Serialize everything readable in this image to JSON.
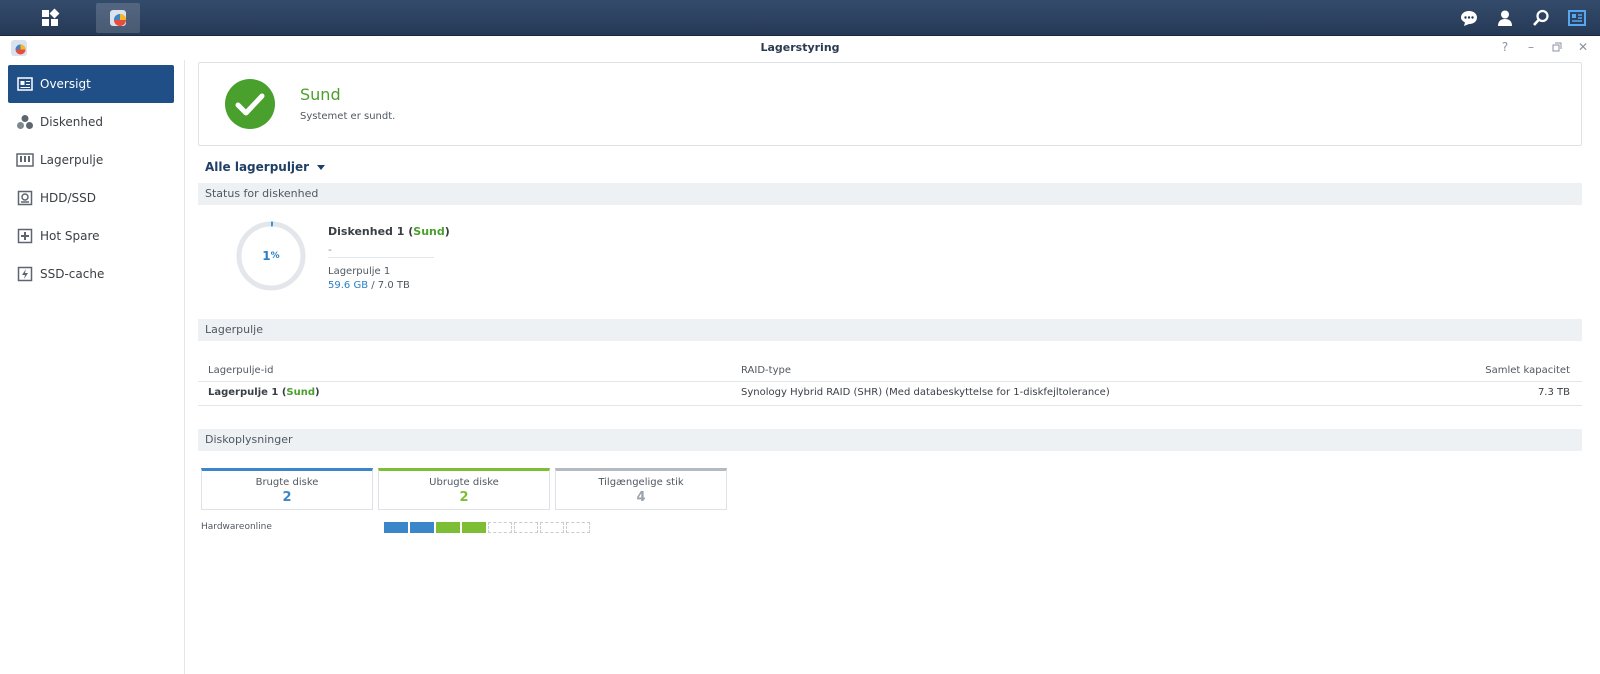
{
  "window": {
    "title": "Lagerstyring"
  },
  "sidebar": {
    "items": [
      {
        "label": "Oversigt",
        "icon": "overview-icon",
        "active": true
      },
      {
        "label": "Diskenhed",
        "icon": "volume-icon",
        "active": false
      },
      {
        "label": "Lagerpulje",
        "icon": "storage-pool-icon",
        "active": false
      },
      {
        "label": "HDD/SSD",
        "icon": "hdd-icon",
        "active": false
      },
      {
        "label": "Hot Spare",
        "icon": "hot-spare-icon",
        "active": false
      },
      {
        "label": "SSD-cache",
        "icon": "ssd-cache-icon",
        "active": false
      }
    ]
  },
  "health": {
    "status": "Sund",
    "message": "Systemet er sundt."
  },
  "pool_selector": {
    "label": "Alle lagerpuljer"
  },
  "volume_section": {
    "heading": "Status for diskenhed",
    "usage_percent": "1",
    "usage_fraction": 0.0085,
    "percent_sign": "%",
    "volume_name": "Diskenhed 1",
    "volume_status": "Sund",
    "description": "-",
    "pool": "Lagerpulje 1",
    "used": "59.6 GB",
    "total": "7.0 TB"
  },
  "pool_section": {
    "heading": "Lagerpulje",
    "columns": {
      "id": "Lagerpulje-id",
      "raid": "RAID-type",
      "capacity": "Samlet kapacitet"
    },
    "rows": [
      {
        "name": "Lagerpulje 1",
        "status": "Sund",
        "raid": "Synology Hybrid RAID (SHR) (Med databeskyttelse for 1-diskfejltolerance)",
        "capacity": "7.3 TB"
      }
    ]
  },
  "disk_section": {
    "heading": "Diskoplysninger",
    "cards": [
      {
        "label": "Brugte diske",
        "value": "2",
        "color": "#3a86c9"
      },
      {
        "label": "Ubrugte diske",
        "value": "2",
        "color": "#7ebe35"
      },
      {
        "label": "Tilgængelige stik",
        "value": "4",
        "color": "#9aa3ad"
      }
    ],
    "hardware_label": "Hardwareonline",
    "slots": [
      "used",
      "used",
      "unused",
      "unused",
      "empty",
      "empty",
      "empty",
      "empty"
    ]
  },
  "colors": {
    "accent": "#1f4f86",
    "healthy": "#4aa02c",
    "used": "#3a86c9",
    "unused": "#7ebe35"
  },
  "taskbar": {
    "left_icons": [
      "main-menu-icon",
      "storage-manager-app-icon"
    ],
    "right_icons": [
      "chat-icon",
      "user-icon",
      "search-icon",
      "widgets-icon"
    ]
  }
}
